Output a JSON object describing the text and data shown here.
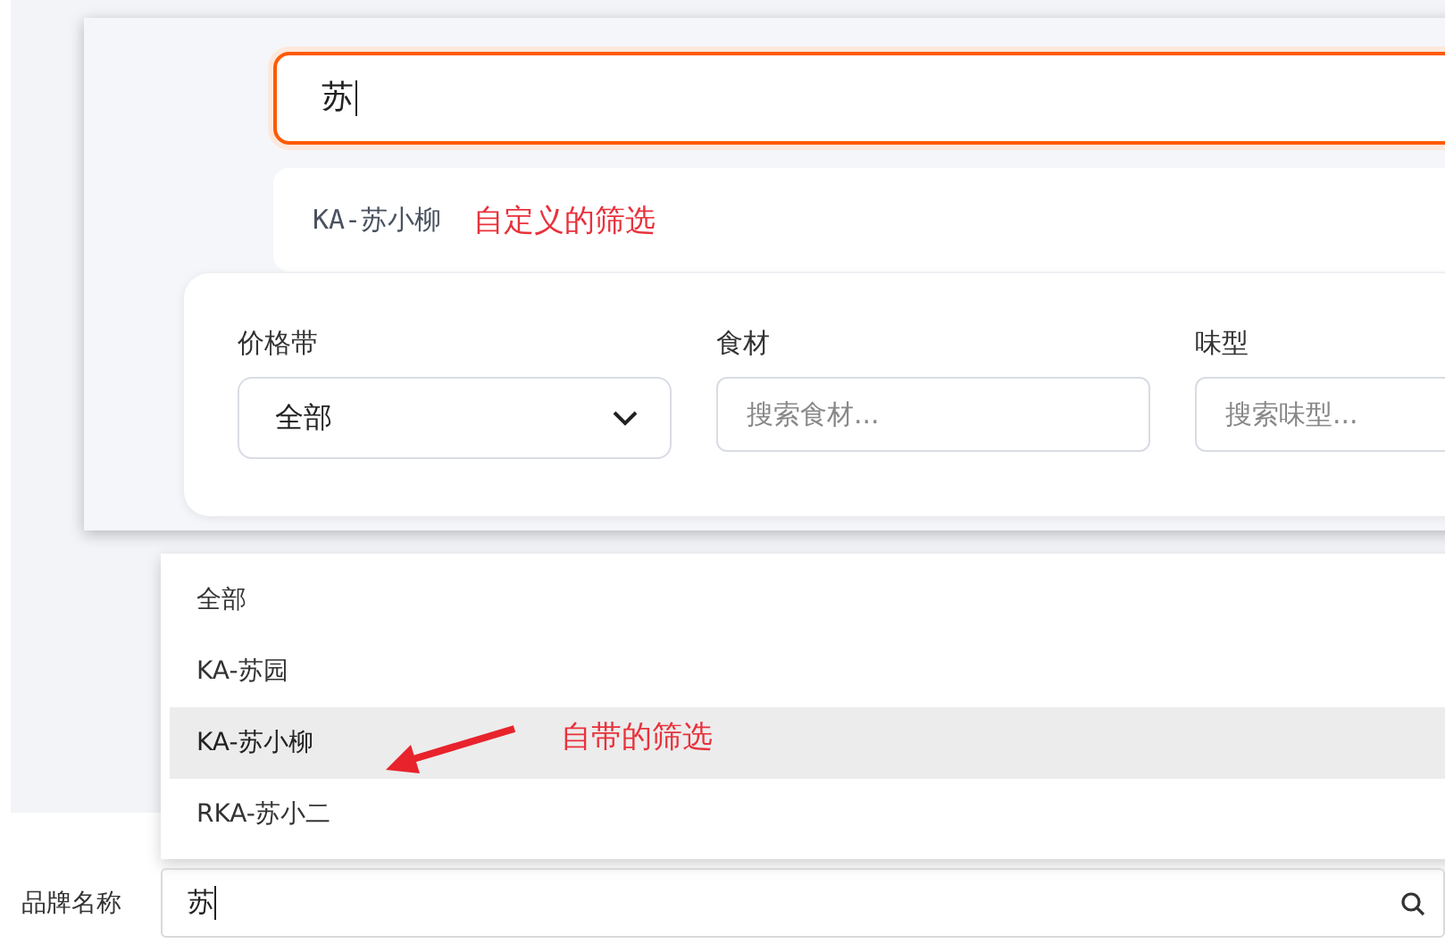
{
  "custom_search": {
    "value": "苏",
    "suggestions": [
      {
        "label": "KA-苏小柳"
      }
    ],
    "annotation": "自定义的筛选"
  },
  "filters": [
    {
      "kind": "select",
      "label": "价格带",
      "value": "全部"
    },
    {
      "kind": "input",
      "label": "食材",
      "placeholder": "搜索食材..."
    },
    {
      "kind": "input",
      "label": "味型",
      "placeholder": "搜索味型..."
    }
  ],
  "brand_dropdown": {
    "options": [
      {
        "label": "全部",
        "selected": false
      },
      {
        "label": "KA-苏园",
        "selected": false
      },
      {
        "label": "KA-苏小柳",
        "selected": true
      },
      {
        "label": "RKA-苏小二",
        "selected": false
      }
    ],
    "annotation": "自带的筛选"
  },
  "brand_field": {
    "label": "品牌名称",
    "value": "苏"
  }
}
